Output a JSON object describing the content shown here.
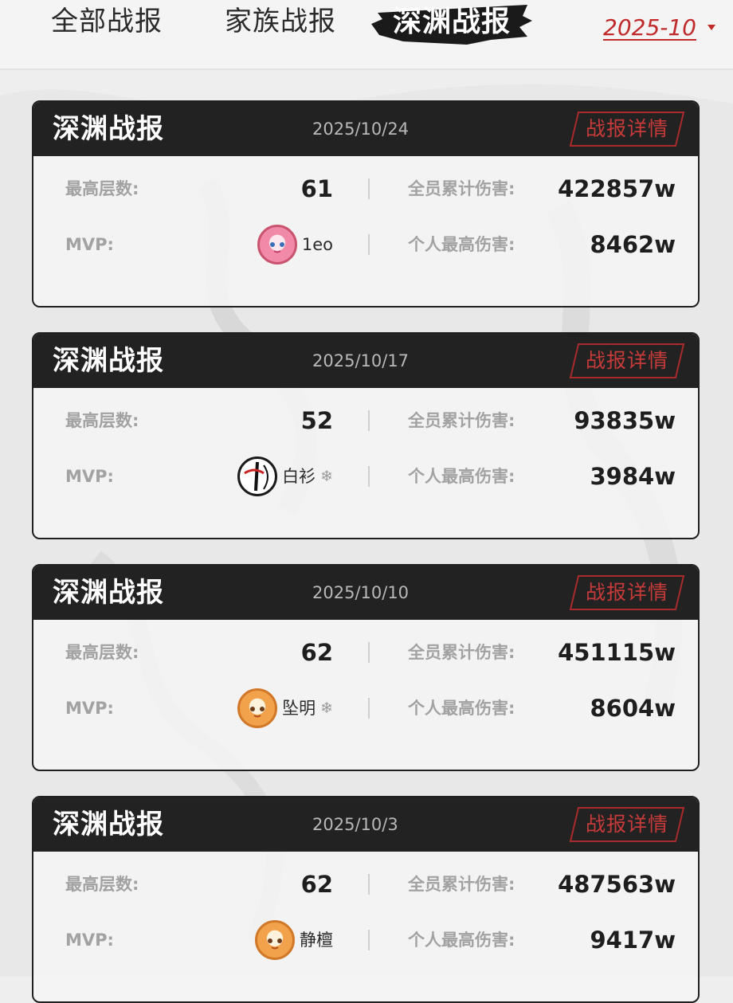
{
  "tabs": {
    "all": "全部战报",
    "clan": "家族战报",
    "abyss": "深渊战报"
  },
  "month": "2025-10",
  "labels": {
    "max_floor": "最高层数:",
    "total_damage": "全员累计伤害:",
    "mvp": "MVP:",
    "personal_damage": "个人最高伤害:",
    "detail": "战报详情"
  },
  "reports": [
    {
      "title": "深渊战报",
      "date": "2025/10/24",
      "max_floor": "61",
      "total_damage": "422857w",
      "mvp": "1eo",
      "personal_damage": "8462w"
    },
    {
      "title": "深渊战报",
      "date": "2025/10/17",
      "max_floor": "52",
      "total_damage": "93835w",
      "mvp": "白衫",
      "personal_damage": "3984w"
    },
    {
      "title": "深渊战报",
      "date": "2025/10/10",
      "max_floor": "62",
      "total_damage": "451115w",
      "mvp": "坠明",
      "personal_damage": "8604w"
    },
    {
      "title": "深渊战报",
      "date": "2025/10/3",
      "max_floor": "62",
      "total_damage": "487563w",
      "mvp": "静檀",
      "personal_damage": "9417w"
    }
  ],
  "snowflake": "❄",
  "colors": {
    "accent_red": "#c02a2a",
    "header_dark": "#222222"
  }
}
